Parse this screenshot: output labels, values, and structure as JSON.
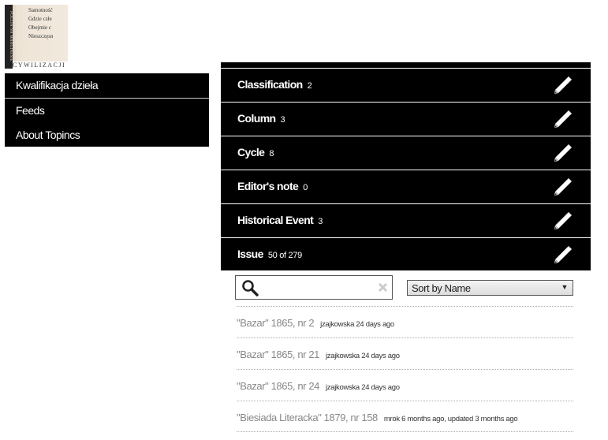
{
  "logo": {
    "spine": "POEZJA NA MARGINESIE",
    "lines": [
      "Samotność",
      "Gdzie człe",
      "Obejmie c",
      "Nieszczęsn"
    ],
    "bottom": "CYWILIZACJI"
  },
  "menu": {
    "items": [
      {
        "label": "Kwalifikacja dzieła"
      },
      {
        "label": "Feeds"
      },
      {
        "label": "About Topincs"
      }
    ]
  },
  "categories": [
    {
      "label": "Classification",
      "count": "2"
    },
    {
      "label": "Column",
      "count": "3"
    },
    {
      "label": "Cycle",
      "count": "8"
    },
    {
      "label": "Editor's note",
      "count": "0"
    },
    {
      "label": "Historical Event",
      "count": "3"
    },
    {
      "label": "Issue",
      "count": "50 of 279"
    }
  ],
  "search": {
    "value": "",
    "placeholder": ""
  },
  "sort": {
    "selected": "Sort by Name"
  },
  "items": [
    {
      "title": "\"Bazar\" 1865, nr 2",
      "meta": "jzajkowska 24 days ago"
    },
    {
      "title": "\"Bazar\" 1865, nr 21",
      "meta": "jzajkowska 24 days ago"
    },
    {
      "title": "\"Bazar\" 1865, nr 24",
      "meta": "jzajkowska 24 days ago"
    },
    {
      "title": "\"Biesiada Literacka\" 1879, nr 158",
      "meta": "mrok 6 months ago, updated 3 months ago"
    }
  ]
}
